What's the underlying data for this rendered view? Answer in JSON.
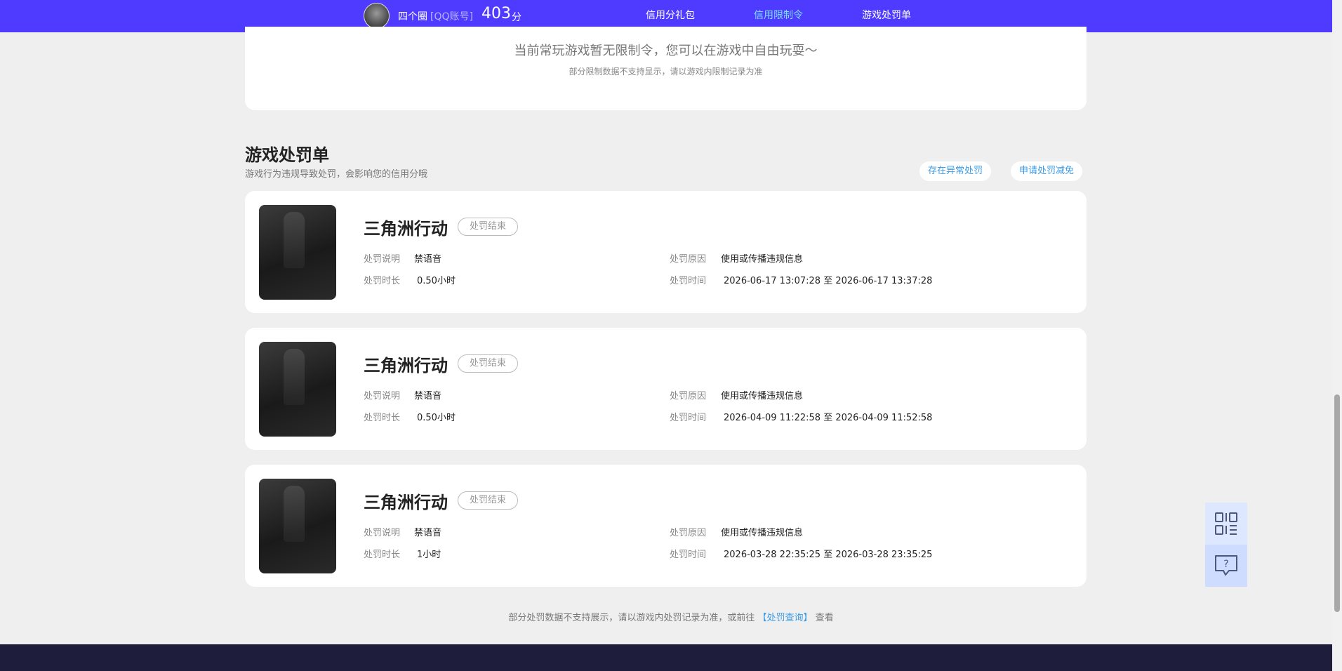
{
  "header": {
    "user_name": "四个圈",
    "account_type": "[QQ账号]",
    "score": "403",
    "score_unit": "分",
    "tabs": [
      {
        "label": "信用分礼包",
        "active": false
      },
      {
        "label": "信用限制令",
        "active": true
      },
      {
        "label": "游戏处罚单",
        "active": false
      }
    ]
  },
  "restriction": {
    "message": "当前常玩游戏暂无限制令，您可以在游戏中自由玩耍～",
    "note": "部分限制数据不支持显示，请以游戏内限制记录为准"
  },
  "penalty_section": {
    "title": "游戏处罚单",
    "subtitle": "游戏行为违规导致处罚，会影响您的信用分哦",
    "btn_abnormal": "存在异常处罚",
    "btn_reduce": "申请处罚减免",
    "labels": {
      "desc": "处罚说明",
      "duration": "处罚时长",
      "reason": "处罚原因",
      "time": "处罚时间"
    },
    "items": [
      {
        "game": "三角洲行动",
        "status": "处罚结束",
        "desc": "禁语音",
        "duration": "0.50小时",
        "reason": "使用或传播违规信息",
        "time": "2026-06-17 13:07:28 至 2026-06-17 13:37:28"
      },
      {
        "game": "三角洲行动",
        "status": "处罚结束",
        "desc": "禁语音",
        "duration": "0.50小时",
        "reason": "使用或传播违规信息",
        "time": "2026-04-09 11:22:58 至 2026-04-09 11:52:58"
      },
      {
        "game": "三角洲行动",
        "status": "处罚结束",
        "desc": "禁语音",
        "duration": "1小时",
        "reason": "使用或传播违规信息",
        "time": "2026-03-28 22:35:25 至 2026-03-28 23:35:25"
      }
    ]
  },
  "footer": {
    "prefix": "部分处罚数据不支持展示，请以游戏内处罚记录为准，或前往",
    "link": "【处罚查询】",
    "suffix": "查看"
  },
  "float_tools": {
    "qr_icon": "qr-code-icon",
    "help_icon": "help-chat-icon"
  }
}
